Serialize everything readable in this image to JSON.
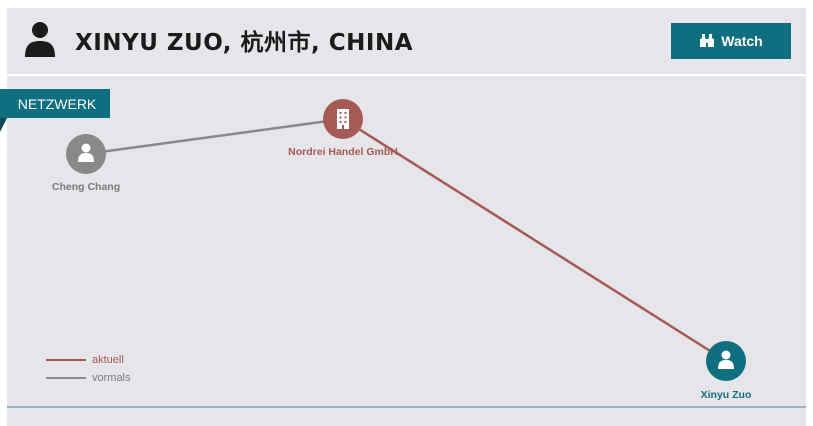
{
  "header": {
    "title": "XINYU ZUO, 杭州市, CHINA",
    "watch_label": "Watch",
    "person_icon": "person-icon",
    "watch_icon": "binoculars-icon"
  },
  "network": {
    "tab_label": "NETZWERK",
    "nodes": [
      {
        "label": "Cheng Chang",
        "type": "person",
        "status": "vormals",
        "color": "#898989",
        "icon": "person-icon"
      },
      {
        "label": "Nordrei Handel GmbH",
        "type": "company",
        "status": "aktuell",
        "color": "#a65a56",
        "icon": "building-icon"
      },
      {
        "label": "Xinyu Zuo",
        "type": "person",
        "status": "focus",
        "color": "#0f6f80",
        "icon": "person-icon"
      }
    ],
    "edges": [
      {
        "from": "Cheng Chang",
        "to": "Nordrei Handel GmbH",
        "status": "vormals"
      },
      {
        "from": "Nordrei Handel GmbH",
        "to": "Xinyu Zuo",
        "status": "aktuell"
      }
    ]
  },
  "legend": {
    "current_label": "aktuell",
    "current_color": "#a65a56",
    "former_label": "vormals",
    "former_color": "#898989"
  }
}
